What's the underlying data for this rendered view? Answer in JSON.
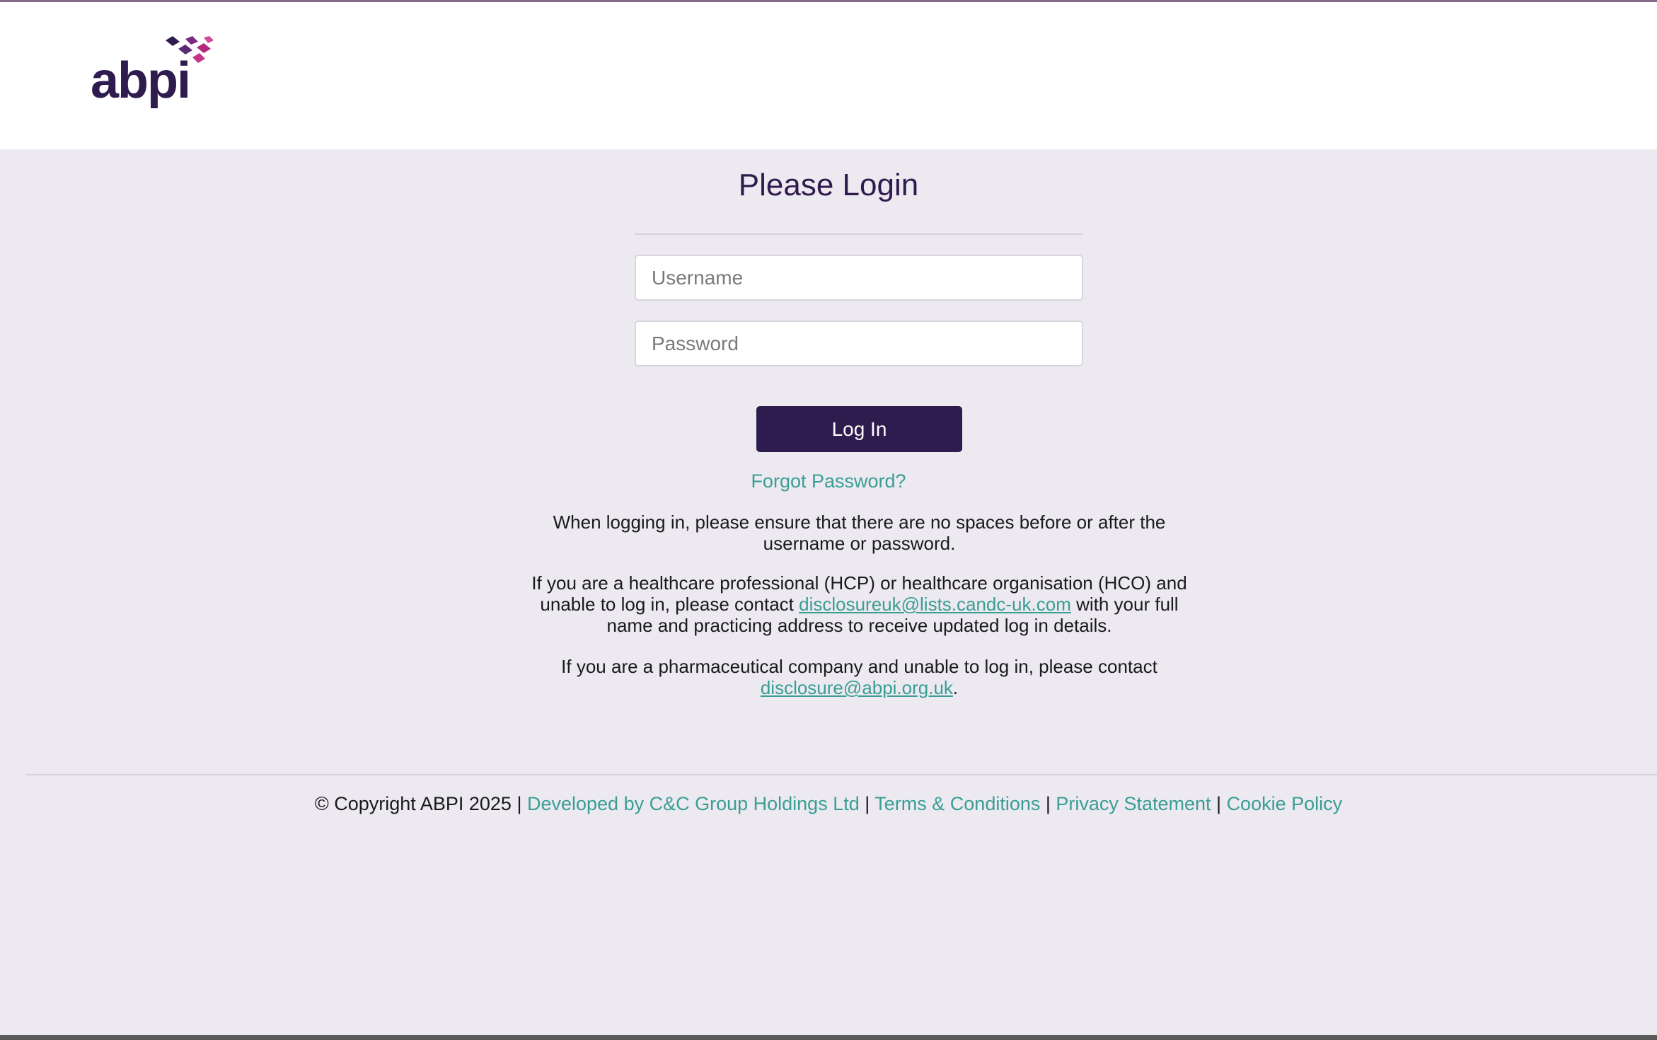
{
  "brand": {
    "logo_text": "abpi",
    "colors": {
      "primary": "#2f1c4e",
      "accent": "#b3297e",
      "link": "#3a9e95",
      "background": "#ece9f0"
    }
  },
  "login": {
    "title": "Please Login",
    "username_placeholder": "Username",
    "password_placeholder": "Password",
    "login_label": "Log In",
    "forgot_label": "Forgot Password?"
  },
  "info": {
    "spaces_note": "When logging in, please ensure that there are no spaces before or after the username or password.",
    "hcp_prefix": "If you are a healthcare professional (HCP) or healthcare organisation (HCO) and unable to log in, please contact ",
    "hcp_email": "disclosureuk@lists.candc-uk.com",
    "hcp_suffix": " with your full name and practicing address to receive updated log in details.",
    "pharma_prefix": "If you are a pharmaceutical company and unable to log in, please contact ",
    "pharma_email": "disclosure@abpi.org.uk",
    "pharma_suffix": "."
  },
  "footer": {
    "copyright": "© Copyright ABPI 2025",
    "separator": "|",
    "developer": "Developed by C&C Group Holdings Ltd",
    "terms": "Terms & Conditions",
    "privacy": "Privacy Statement",
    "cookie": "Cookie Policy"
  }
}
